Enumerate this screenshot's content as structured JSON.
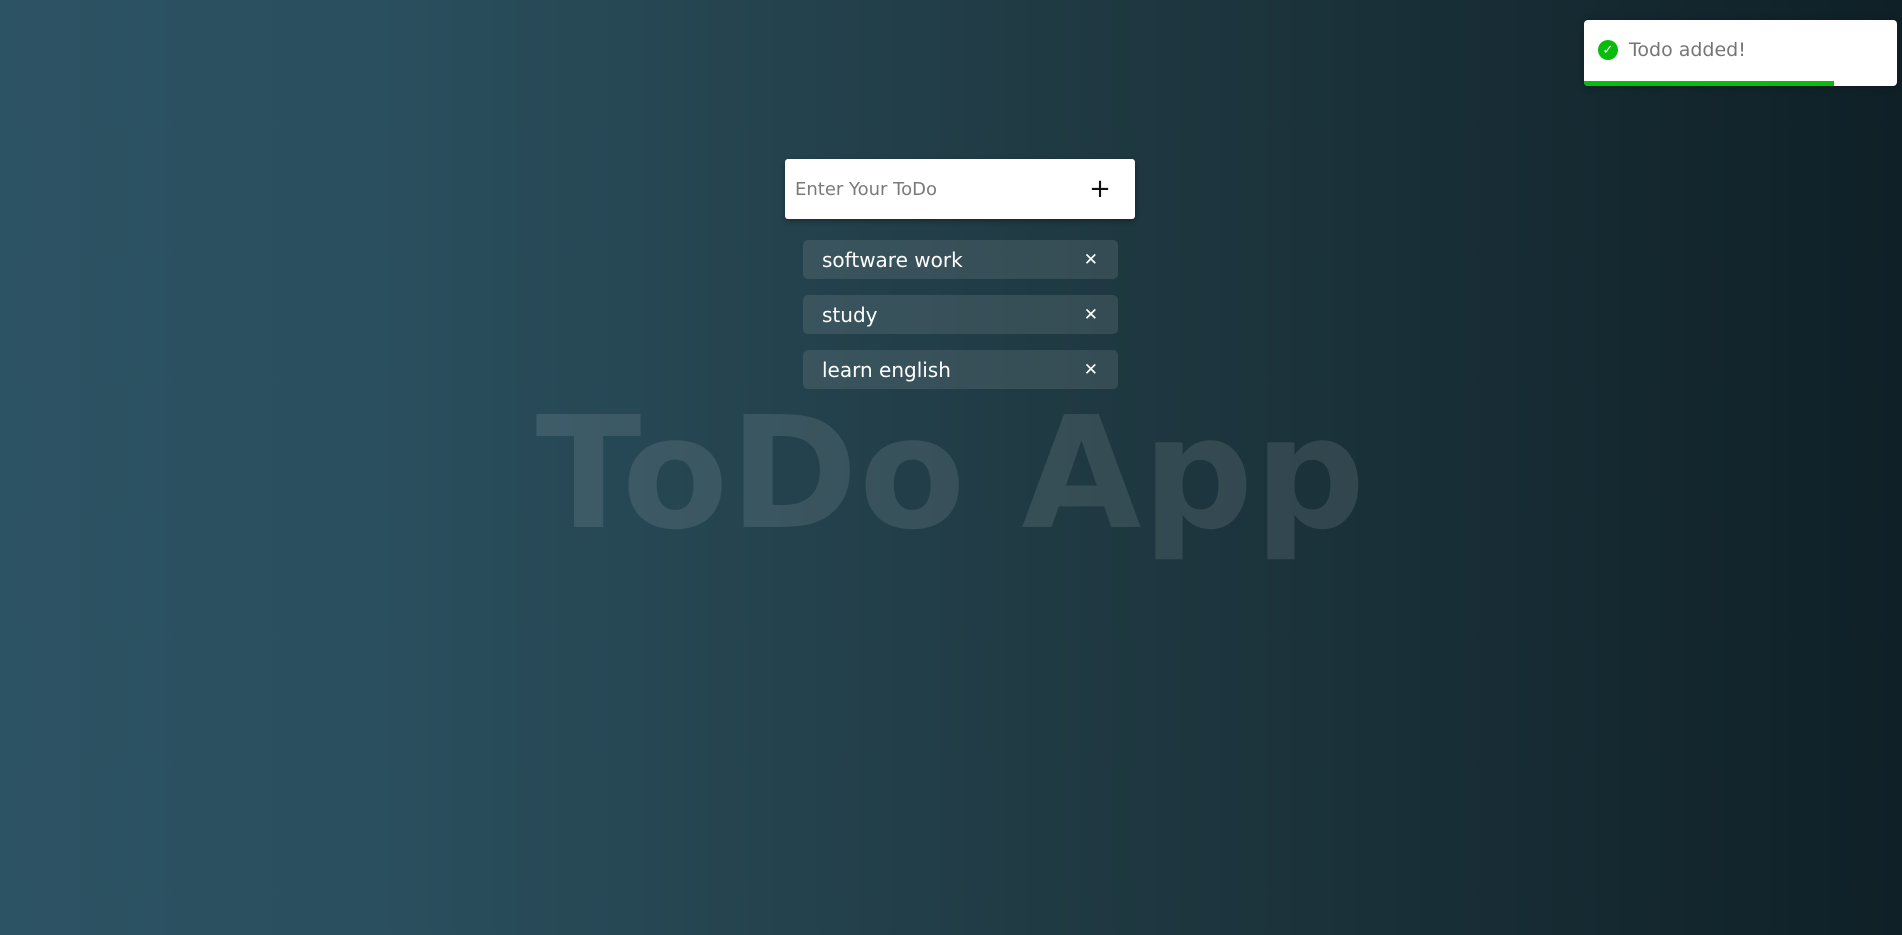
{
  "app": {
    "watermark_title": "ToDo App"
  },
  "form": {
    "input_placeholder": "Enter Your ToDo",
    "input_value": "",
    "add_icon": "plus-icon",
    "add_symbol": "+"
  },
  "todos": [
    {
      "text": "software work",
      "delete_symbol": "✕"
    },
    {
      "text": "study",
      "delete_symbol": "✕"
    },
    {
      "text": "learn english",
      "delete_symbol": "✕"
    }
  ],
  "toast": {
    "message": "Todo added!",
    "icon": "check-circle-icon",
    "icon_symbol": "✓",
    "progress": 0.8,
    "accent_color": "#07bc0c"
  },
  "colors": {
    "background_start": "#2c5364",
    "background_end": "#0f2027"
  }
}
